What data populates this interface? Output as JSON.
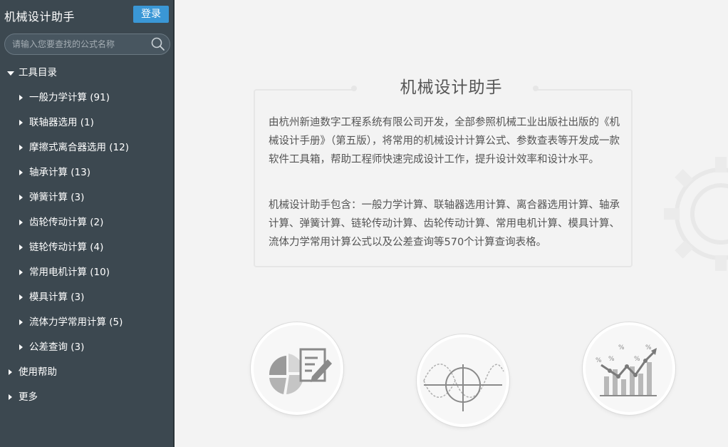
{
  "header": {
    "app_title": "机械设计助手",
    "login_label": "登录"
  },
  "search": {
    "placeholder": "请输入您要查找的公式名称",
    "value": ""
  },
  "tree": {
    "root_label": "工具目录",
    "items": [
      {
        "label": "一般力学计算 (91)"
      },
      {
        "label": "联轴器选用 (1)"
      },
      {
        "label": "摩擦式离合器选用 (12)"
      },
      {
        "label": "轴承计算 (13)"
      },
      {
        "label": "弹簧计算 (3)"
      },
      {
        "label": "齿轮传动计算 (2)"
      },
      {
        "label": "链轮传动计算 (4)"
      },
      {
        "label": "常用电机计算 (10)"
      },
      {
        "label": "模具计算 (3)"
      },
      {
        "label": "流体力学常用计算 (5)"
      },
      {
        "label": "公差查询 (3)"
      }
    ],
    "help_label": "使用帮助",
    "more_label": "更多"
  },
  "intro": {
    "title": "机械设计助手",
    "paragraph1": "由杭州新迪数字工程系统有限公司开发，全部参照机械工业出版社出版的《机械设计手册》（第五版），将常用的机械设计计算公式、参数查表等开发成一款软件工具箱，帮助工程师快速完成设计工作，提升设计效率和设计水平。",
    "paragraph2": "机械设计助手包含：一般力学计算、联轴器选用计算、离合器选用计算、轴承计算、弹簧计算、链轮传动计算、齿轮传动计算、常用电机计算、模具计算、流体力学常用计算公式以及公差查询等570个计算查询表格。"
  },
  "icons": {
    "feature_1": "pie-chart-document-icon",
    "feature_2": "crosshair-wave-icon",
    "feature_3": "bar-trend-percent-icon",
    "search": "search-icon"
  },
  "colors": {
    "sidebar_bg": "#3c4850",
    "accent": "#3a97d6",
    "main_bg": "#f3f3f3",
    "text_gray": "#555555"
  }
}
